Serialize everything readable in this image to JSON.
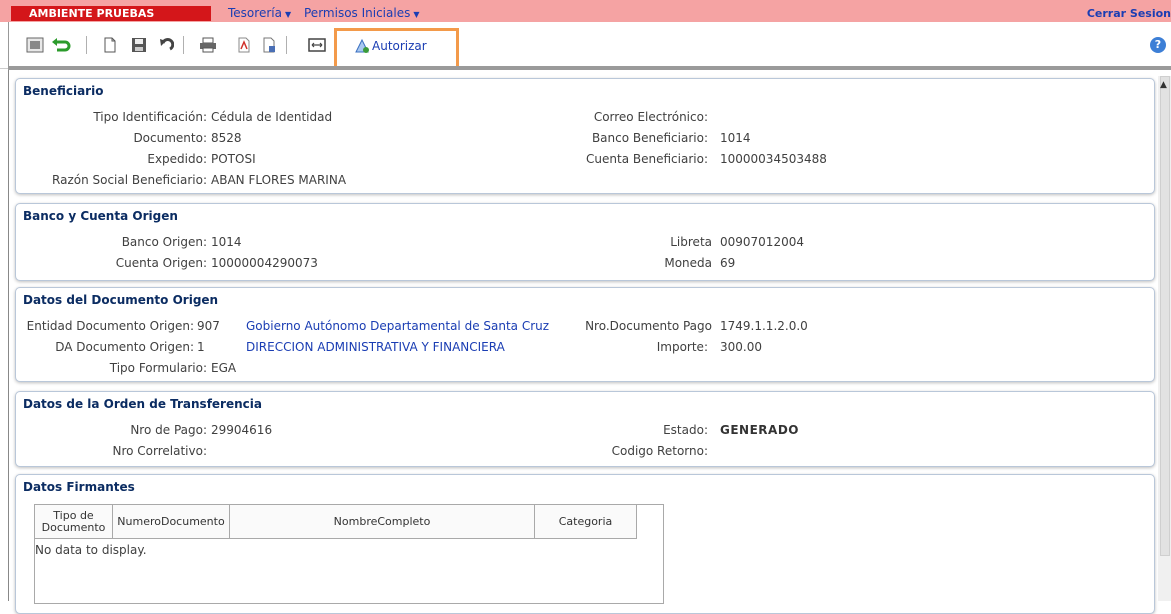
{
  "header": {
    "environment": "AMBIENTE PRUEBAS",
    "menus": [
      {
        "label": "Tesorería"
      },
      {
        "label": "Permisos Iniciales"
      }
    ],
    "logout": "Cerrar Sesion"
  },
  "toolbar": {
    "autorizar_label": "Autorizar",
    "help_label": "?"
  },
  "beneficiario": {
    "title": "Beneficiario",
    "tipo_identificacion_label": "Tipo Identificación:",
    "tipo_identificacion": "Cédula de Identidad",
    "documento_label": "Documento:",
    "documento": "8528",
    "expedido_label": "Expedido:",
    "expedido": "POTOSI",
    "razon_social_label": "Razón Social Beneficiario:",
    "razon_social": "ABAN FLORES MARINA",
    "correo_label": "Correo Electrónico:",
    "banco_label": "Banco Beneficiario:",
    "banco": "1014",
    "cuenta_label": "Cuenta Beneficiario:",
    "cuenta": "10000034503488"
  },
  "banco_origen": {
    "title": "Banco y Cuenta Origen",
    "banco_label": "Banco Origen:",
    "banco": "1014",
    "cuenta_label": "Cuenta Origen:",
    "cuenta": "10000004290073",
    "libreta_label": "Libreta",
    "libreta": "00907012004",
    "moneda_label": "Moneda",
    "moneda": "69"
  },
  "documento_origen": {
    "title": "Datos del Documento Origen",
    "entidad_label": "Entidad Documento Origen:",
    "entidad_code": "907",
    "entidad_name": "Gobierno Autónomo Departamental de Santa Cruz",
    "da_label": "DA Documento Origen:",
    "da_code": "1",
    "da_name": "DIRECCION ADMINISTRATIVA Y FINANCIERA",
    "tipo_formulario_label": "Tipo Formulario:",
    "tipo_formulario": "EGA",
    "nro_documento_label": "Nro.Documento Pago",
    "nro_documento": "1749.1.1.2.0.0",
    "importe_label": "Importe:",
    "importe": "300.00"
  },
  "orden_transferencia": {
    "title": "Datos de la Orden de Transferencia",
    "nro_pago_label": "Nro de Pago:",
    "nro_pago": "29904616",
    "nro_correlativo_label": "Nro Correlativo:",
    "estado_label": "Estado:",
    "estado": "GENERADO",
    "codigo_retorno_label": "Codigo Retorno:"
  },
  "firmantes": {
    "title": "Datos Firmantes",
    "columns": [
      "Tipo de Documento",
      "NumeroDocumento",
      "NombreCompleto",
      "Categoria"
    ],
    "empty_text": "No data to display."
  }
}
